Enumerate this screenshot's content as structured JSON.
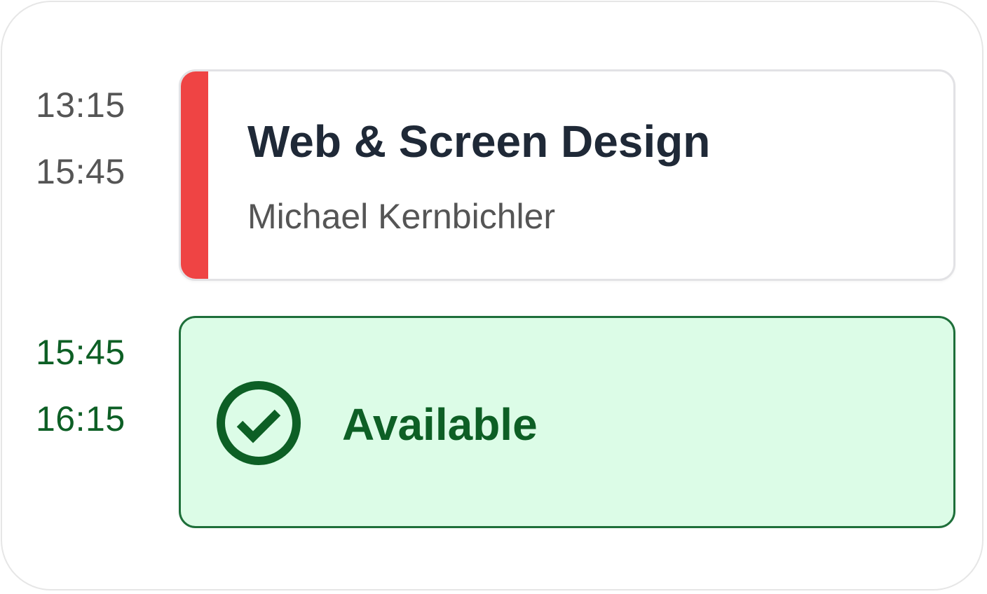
{
  "schedule": {
    "entries": [
      {
        "start": "13:15",
        "end": "15:45",
        "title": "Web & Screen Design",
        "teacher": "Michael Kernbichler",
        "accent_color": "#ef4444"
      },
      {
        "start": "15:45",
        "end": "16:15",
        "status_label": "Available",
        "icon": "check-circle-icon",
        "color": "#0d5f25",
        "background": "#dcfce7"
      }
    ]
  }
}
